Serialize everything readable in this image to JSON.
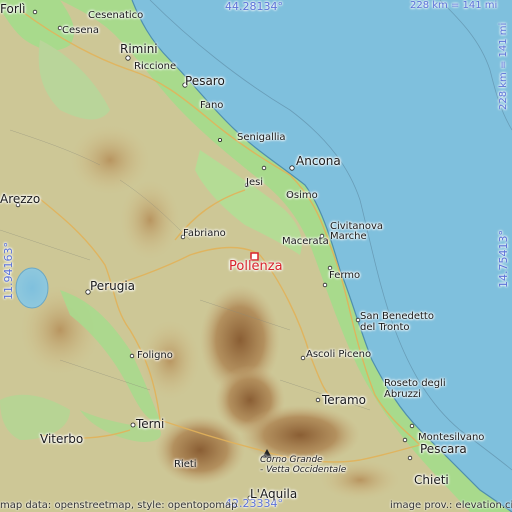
{
  "coordinates": {
    "top": "44.28134°",
    "bottom": "42.23334°",
    "left": "11.94163°",
    "right": "14.75413°"
  },
  "scale": {
    "horizontal": "228 km = 141 mi",
    "vertical": "228 km = 141 mi"
  },
  "focus_place": "Pollenza",
  "places": {
    "forli": "Forlì",
    "cesenatico": "Cesenatico",
    "cesena": "Cesena",
    "rimini": "Rimini",
    "riccione": "Riccione",
    "pesaro": "Pesaro",
    "fano": "Fano",
    "senigallia": "Senigallia",
    "ancona": "Ancona",
    "jesi": "Jesi",
    "osimo": "Osimo",
    "arezzo": "Arezzo",
    "fabriano": "Fabriano",
    "macerata": "Macerata",
    "civitanova": "Civitanova\nMarche",
    "fermo": "Fermo",
    "perugia": "Perugia",
    "foligno": "Foligno",
    "san_benedetto": "San Benedetto\ndel Tronto",
    "ascoli": "Ascoli Piceno",
    "roseto": "Roseto degli\nAbruzzi",
    "teramo": "Teramo",
    "terni": "Terni",
    "montesilvano": "Montesilvano",
    "pescara": "Pescara",
    "chieti": "Chieti",
    "viterbo": "Viterbo",
    "rieti": "Rieti",
    "laquila": "L'Aquila",
    "corno_grande": "Corno Grande\n- Vetta Occidentale"
  },
  "credits": {
    "left": "map data: openstreetmap, style: opentopomap",
    "right": "image prov.: elevation.city"
  },
  "colors": {
    "sea": "#7fc0dd",
    "lowland": "#9fd98a",
    "hills": "#c9c896",
    "mountains": "#a9834f",
    "focus": "#d8242c",
    "coord": "#5b72d8"
  }
}
